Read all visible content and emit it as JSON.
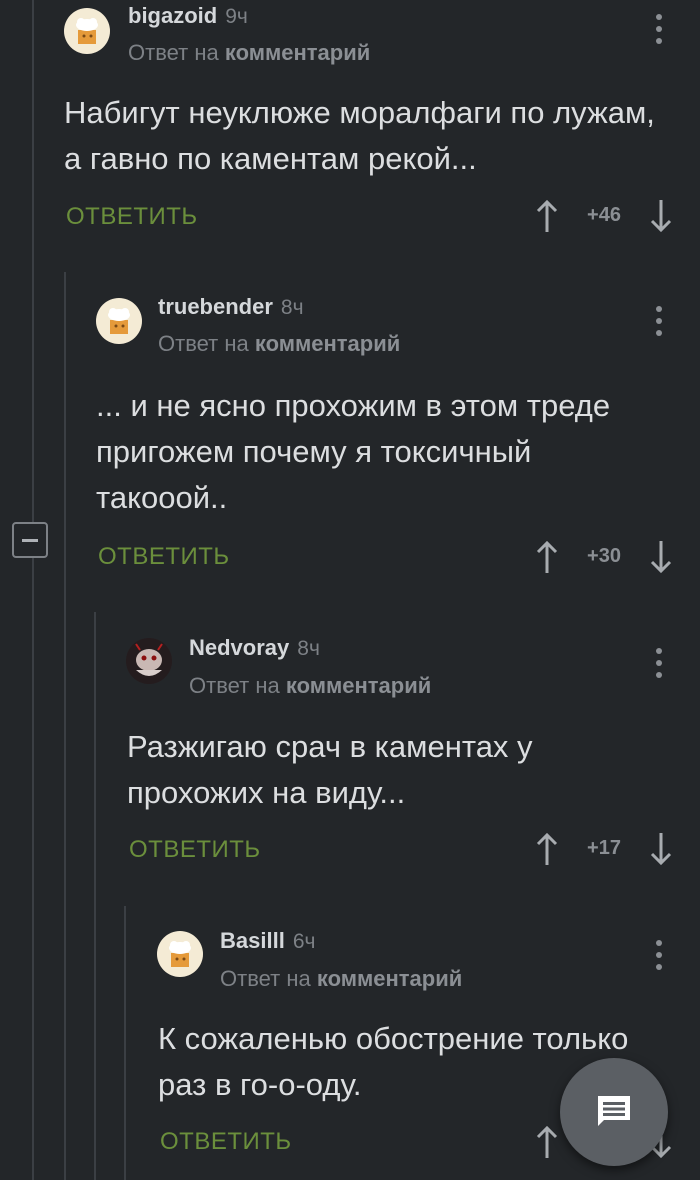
{
  "comments": [
    {
      "username": "bigazoid",
      "time": "9ч",
      "reply_prefix": "Ответ на",
      "reply_link": "комментарий",
      "text": "Набигут неуклюже моралфаги по лужам, а гавно по каментам рекой...",
      "reply_label": "ОТВЕТИТЬ",
      "score": "+46",
      "avatar": "pikabu-default-avatar"
    },
    {
      "username": "truebender",
      "time": "8ч",
      "reply_prefix": "Ответ на",
      "reply_link": "комментарий",
      "text": "... и не ясно прохожим в этом треде пригожем почему я токсичный такооой..",
      "reply_label": "ОТВЕТИТЬ",
      "score": "+30",
      "avatar": "pikabu-default-avatar"
    },
    {
      "username": "Nedvoray",
      "time": "8ч",
      "reply_prefix": "Ответ на",
      "reply_link": "комментарий",
      "text": "Разжигаю срач в каментах у прохожих на виду...",
      "reply_label": "ОТВЕТИТЬ",
      "score": "+17",
      "avatar": "custom-avatar"
    },
    {
      "username": "Basilll",
      "time": "6ч",
      "reply_prefix": "Ответ на",
      "reply_link": "комментарий",
      "text": "К сожаленью обострение только раз в го-о-оду.",
      "reply_label": "ОТВЕТИТЬ",
      "score": "",
      "avatar": "pikabu-default-avatar"
    }
  ],
  "colors": {
    "background": "#232629",
    "accent_green": "#6b8f3c",
    "muted": "#7d8186"
  },
  "icons": {
    "more": "more-vertical-icon",
    "upvote": "arrow-up-icon",
    "downvote": "arrow-down-icon",
    "collapse": "minus-box-icon",
    "fab": "comment-icon"
  }
}
